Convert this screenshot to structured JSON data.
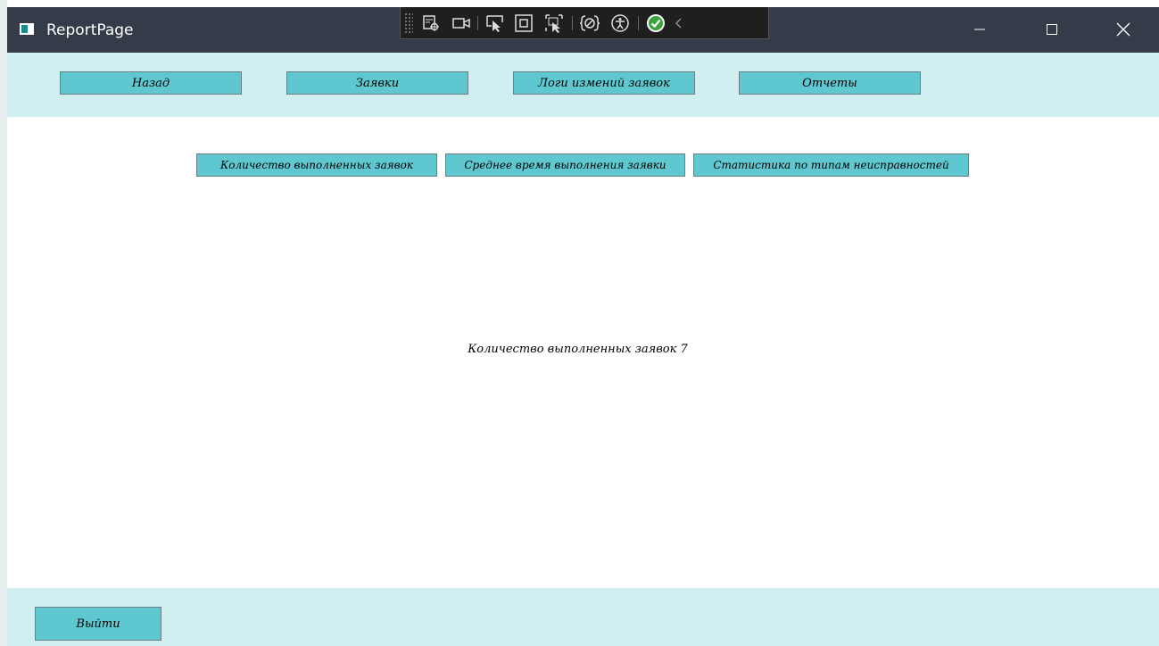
{
  "window": {
    "title": "ReportPage"
  },
  "devtools": {
    "icons": [
      "live-visual-tree-icon",
      "record-icon",
      "select-element-icon",
      "display-layout-adorners-icon",
      "track-focus-icon",
      "binding-failures-icon",
      "accessibility-icon",
      "ui-checker-ok-icon",
      "collapse-icon"
    ]
  },
  "nav": {
    "back_label": "Назад",
    "requests_label": "Заявки",
    "logs_label": "Логи измений заявок",
    "reports_label": "Отчеты"
  },
  "reports": {
    "completed_count_label": "Количество выполненных заявок",
    "avg_time_label": "Среднее время выполнения заявки",
    "fault_stats_label": "Статистика по типам неисправностей"
  },
  "result": {
    "text": "Количество выполненных заявок 7"
  },
  "footer": {
    "exit_label": "Выйти"
  },
  "colors": {
    "titlebar": "#333c48",
    "panel": "#d1eff1",
    "button": "#5fc7cf",
    "button_border": "#6d7f83"
  }
}
